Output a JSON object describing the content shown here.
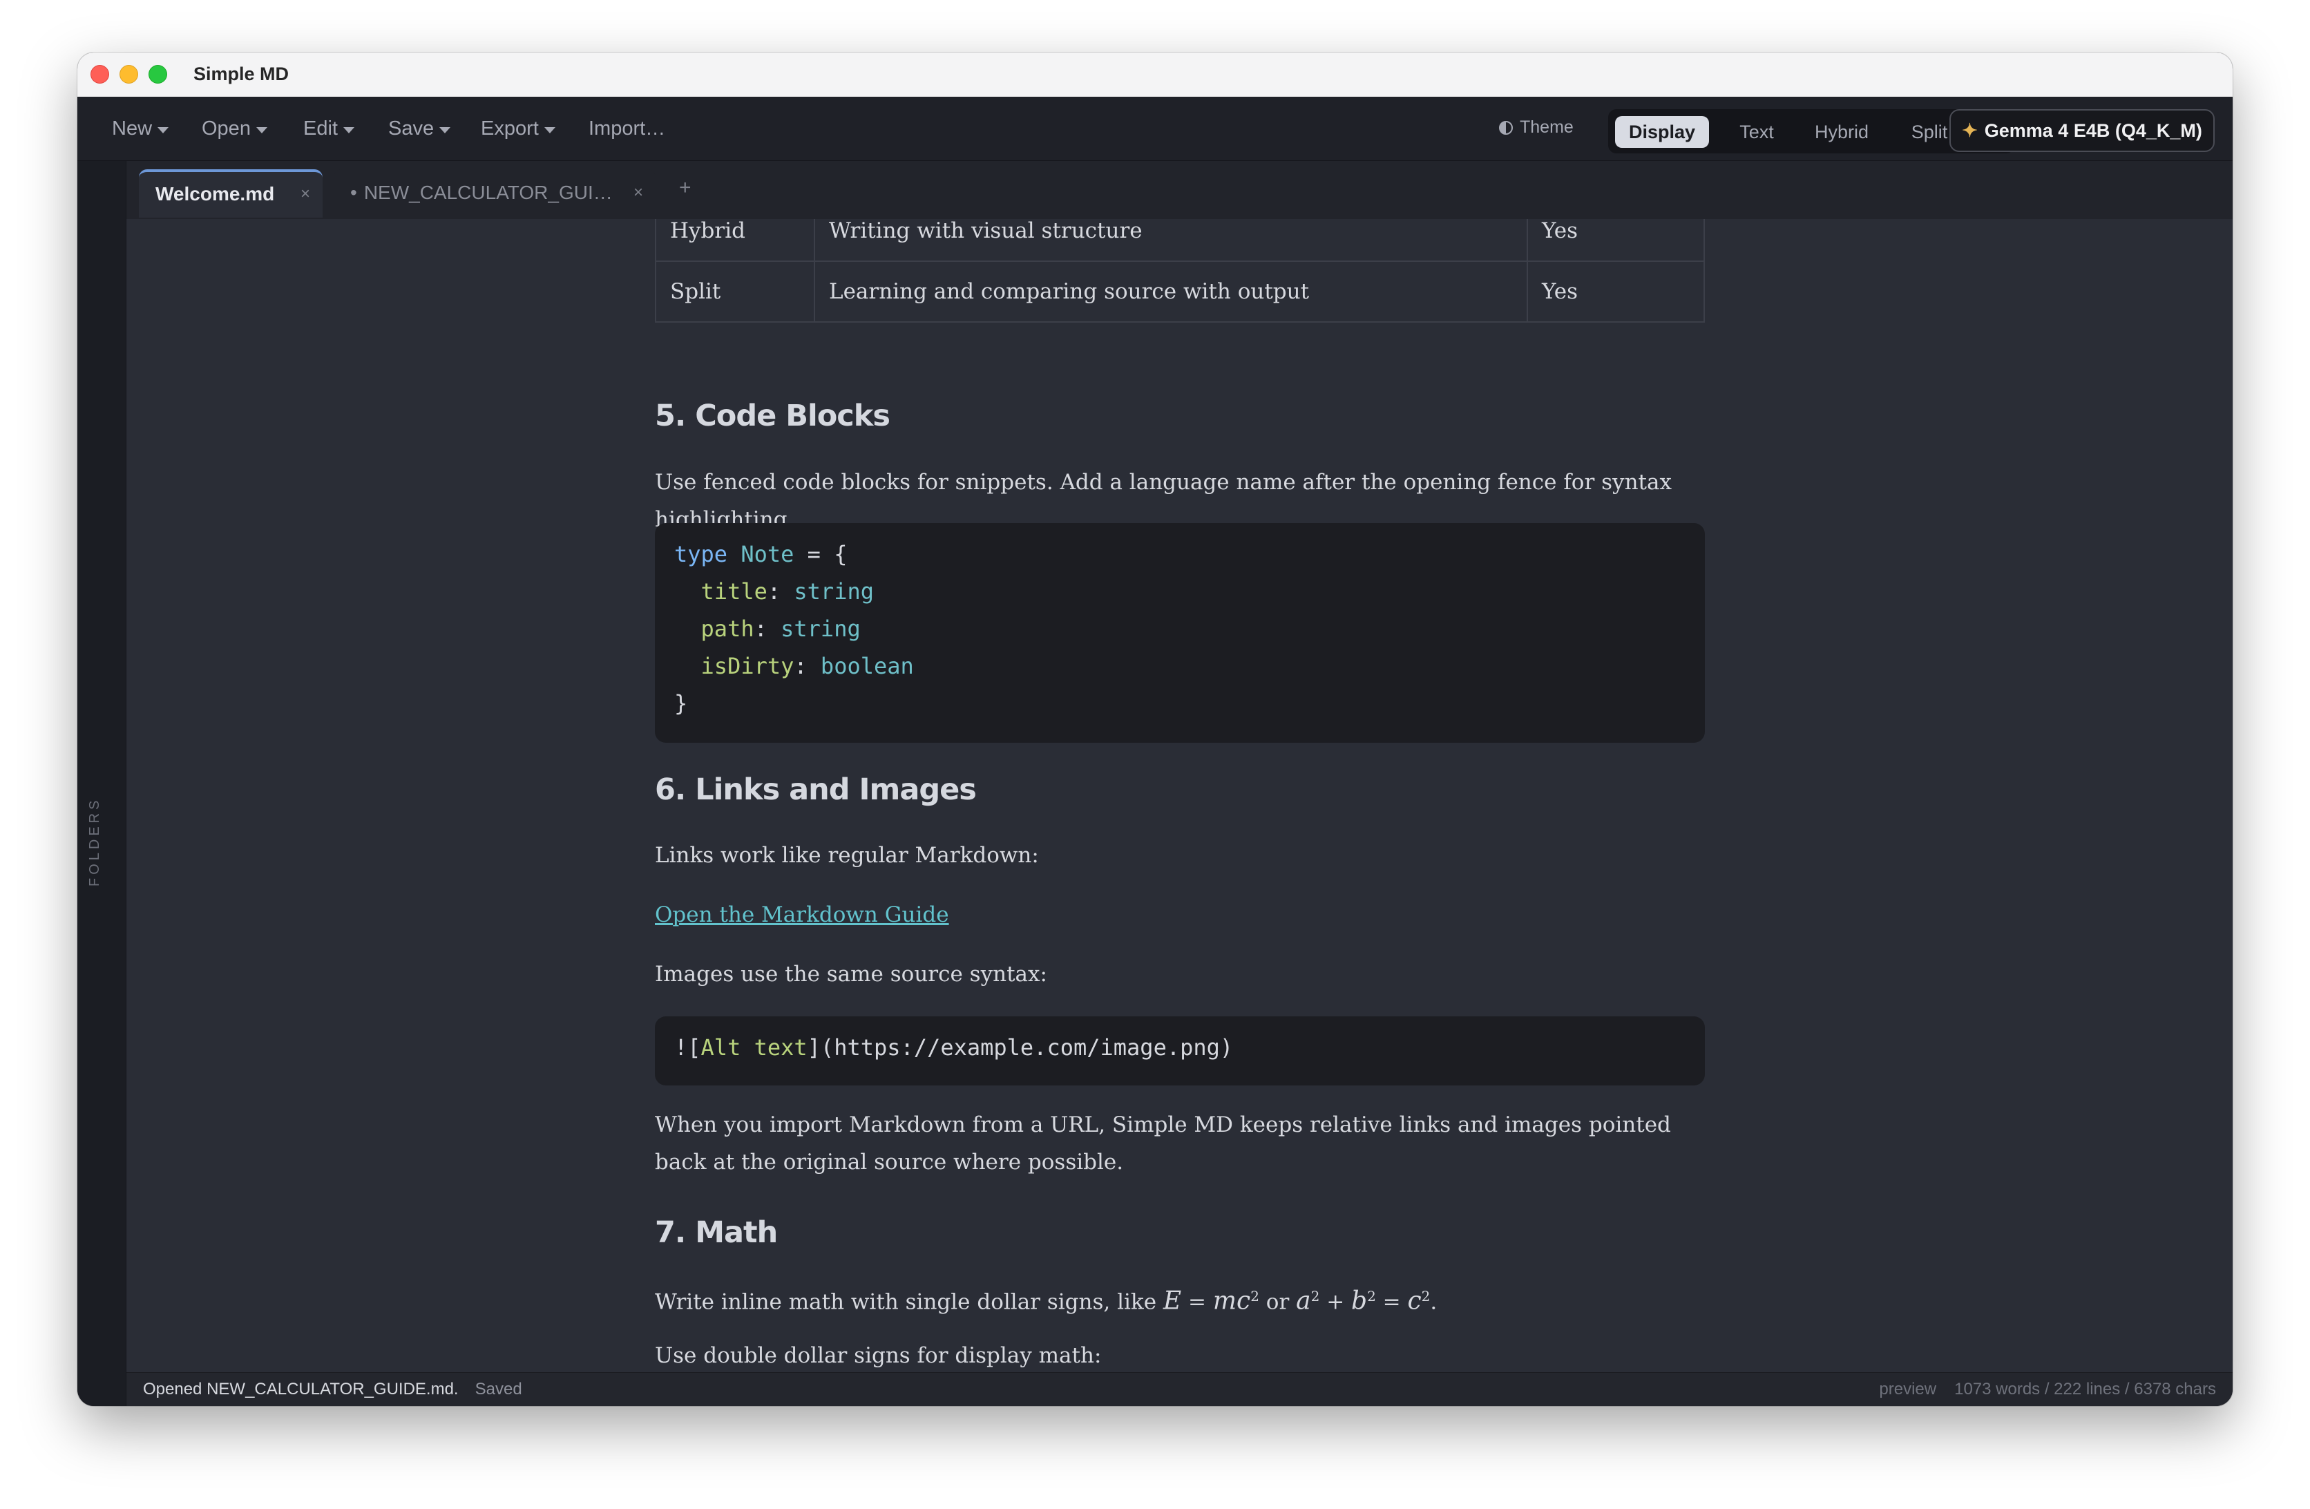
{
  "window": {
    "title": "Simple MD"
  },
  "toolbar": {
    "menus": [
      "New",
      "Open",
      "Edit",
      "Save",
      "Export"
    ],
    "import_label": "Import…",
    "theme_label": "Theme",
    "modes": [
      "Display",
      "Text",
      "Hybrid",
      "Split"
    ],
    "active_mode": "Display",
    "model_label": "Gemma 4 E4B (Q4_K_M)",
    "model_icon": "sparkle-icon"
  },
  "sidebar": {
    "label": "FOLDERS"
  },
  "tabs": [
    {
      "label": "Welcome.md",
      "active": true,
      "close": "×"
    },
    {
      "label": "NEW_CALCULATOR_GUI…",
      "active": false,
      "modified_dot": "•",
      "close": "×"
    }
  ],
  "tab_add": "+",
  "document": {
    "table_rows": [
      [
        "Hybrid",
        "Writing with visual structure",
        "Yes"
      ],
      [
        "Split",
        "Learning and comparing source with output",
        "Yes"
      ]
    ],
    "section5": {
      "heading": "5. Code Blocks",
      "text": "Use fenced code blocks for snippets. Add a language name after the opening fence for syntax highlighting.",
      "code": {
        "line1_kw": "type",
        "line1_name": "Note",
        "line1_rest": " = {",
        "fields": [
          {
            "name": "title",
            "type": "string"
          },
          {
            "name": "path",
            "type": "string"
          },
          {
            "name": "isDirty",
            "type": "boolean"
          }
        ],
        "close": "}"
      }
    },
    "section6": {
      "heading": "6. Links and Images",
      "text1": "Links work like regular Markdown:",
      "link": "Open the Markdown Guide",
      "text2": "Images use the same source syntax:",
      "code_prefix": "![",
      "code_alt": "Alt text",
      "code_rest": "](https://example.com/image.png)",
      "text3": "When you import Markdown from a URL, Simple MD keeps relative links and images pointed back at the original source where possible."
    },
    "section7": {
      "heading": "7. Math",
      "text1_prefix": "Write inline math with single dollar signs, like ",
      "text1_or": " or ",
      "text2": "Use double dollar signs for display math:"
    }
  },
  "status": {
    "message": "Opened NEW_CALCULATOR_GUIDE.md.",
    "saved": "Saved",
    "mode": "preview",
    "counts": "1073 words / 222 lines / 6378 chars"
  }
}
